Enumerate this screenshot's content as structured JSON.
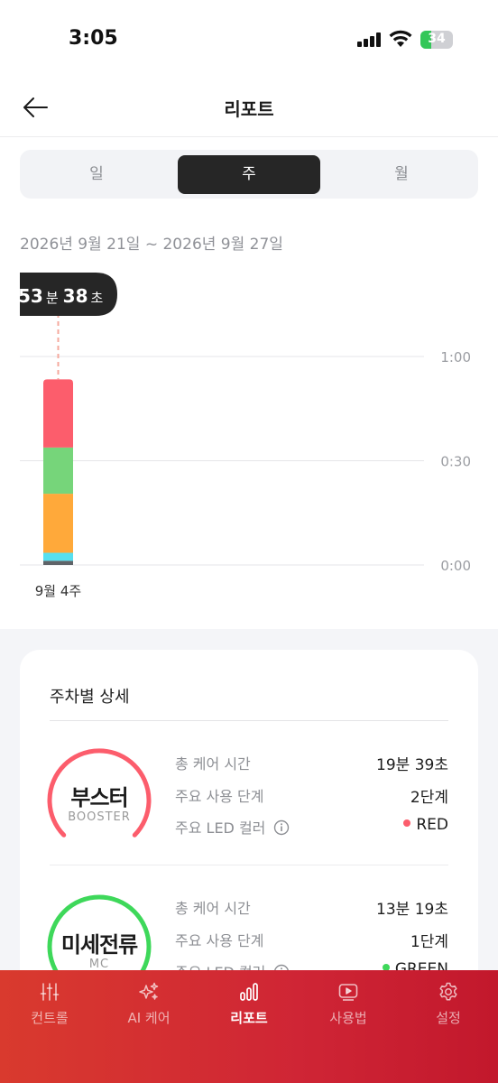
{
  "status": {
    "time": "3:05",
    "battery": "34"
  },
  "header": {
    "title": "리포트"
  },
  "tabs_period": [
    {
      "label": "일"
    },
    {
      "label": "주"
    },
    {
      "label": "월"
    }
  ],
  "range": "2026년 9월 21일 ~ 2026년 9월 27일",
  "tooltip": {
    "min": "53",
    "min_unit": "분",
    "sec": "38",
    "sec_unit": "초"
  },
  "chart_data": {
    "type": "bar",
    "stacked": true,
    "categories": [
      "9월 4주"
    ],
    "y_ticks": [
      "0:00",
      "0:30",
      "1:00"
    ],
    "ylim_minutes": [
      0,
      60
    ],
    "series": [
      {
        "color": "#5f6368",
        "values": [
          1.2
        ]
      },
      {
        "color": "#57e0f0",
        "values": [
          2.3
        ]
      },
      {
        "color": "#ffa93a",
        "values": [
          17
        ]
      },
      {
        "color": "#76d57a",
        "values": [
          13.3
        ]
      },
      {
        "color": "#fc5d6c",
        "values": [
          19.6
        ]
      }
    ]
  },
  "detail": {
    "title": "주차별 상세",
    "items": [
      {
        "name": "부스터",
        "sub": "BOOSTER",
        "ring_color": "#fc5d6c",
        "rows": [
          {
            "label": "총 케어 시간",
            "value": "19분 39초"
          },
          {
            "label": "주요 사용 단계",
            "value": "2단계"
          },
          {
            "label": "주요 LED 컬러",
            "value": "RED",
            "dot": "#fc5d6c"
          }
        ]
      },
      {
        "name": "미세전류",
        "sub": "MC",
        "ring_color": "#3ed85a",
        "rows": [
          {
            "label": "총 케어 시간",
            "value": "13분 19초"
          },
          {
            "label": "주요 사용 단계",
            "value": "1단계"
          },
          {
            "label": "주요 LED 컬러",
            "value": "GREEN",
            "dot": "#3ed85a"
          }
        ]
      }
    ]
  },
  "tabbar": [
    {
      "label": "컨트롤",
      "icon": "sliders-icon"
    },
    {
      "label": "AI 케어",
      "icon": "sparkle-icon"
    },
    {
      "label": "리포트",
      "icon": "bar-chart-icon",
      "active": true
    },
    {
      "label": "사용법",
      "icon": "play-icon"
    },
    {
      "label": "설정",
      "icon": "gear-icon"
    }
  ]
}
